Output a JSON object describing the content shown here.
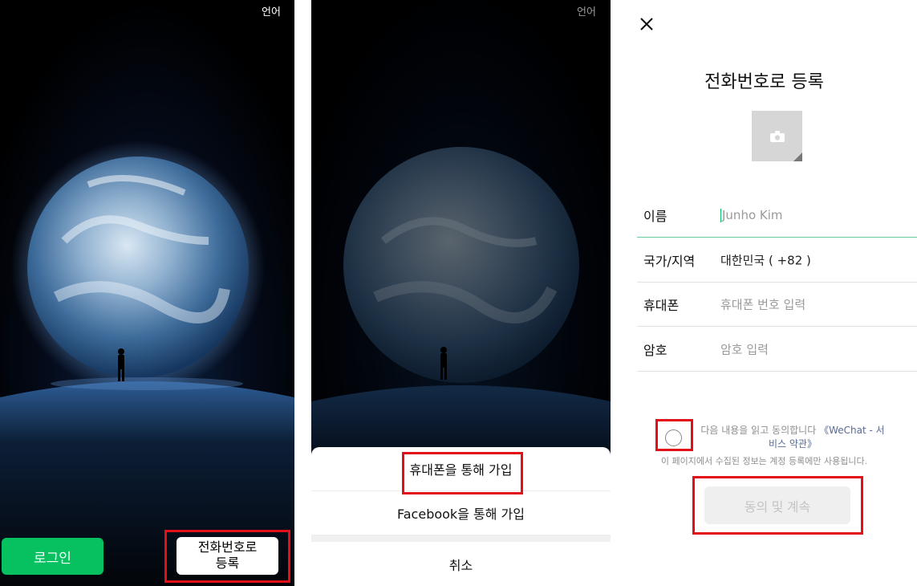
{
  "panel1": {
    "language": "언어",
    "login_button": "로그인",
    "register_button": "전화번호로 등록"
  },
  "panel2": {
    "language": "언어",
    "sheet": {
      "phone_signup": "휴대폰을 통해 가입",
      "facebook_signup": "Facebook을 통해 가입",
      "cancel": "취소"
    }
  },
  "panel3": {
    "title": "전화번호로 등록",
    "form": {
      "name_label": "이름",
      "name_placeholder": "Junho Kim",
      "region_label": "국가/지역",
      "region_value": "대한민국 ( +82 )",
      "phone_label": "휴대폰",
      "phone_placeholder": "휴대폰 번호 입력",
      "password_label": "암호",
      "password_placeholder": "암호 입력"
    },
    "agreement": {
      "text": "다음 내용을 읽고 동의합니다 ",
      "link": "《WeChat - 서비스 약관》",
      "note": "이 페이지에서 수집된 정보는 계정 등록에만 사용됩니다."
    },
    "continue_button": "동의 및 계속"
  },
  "colors": {
    "wechat_green": "#07c160",
    "highlight_red": "#e3101a",
    "link_blue": "#576b95"
  }
}
